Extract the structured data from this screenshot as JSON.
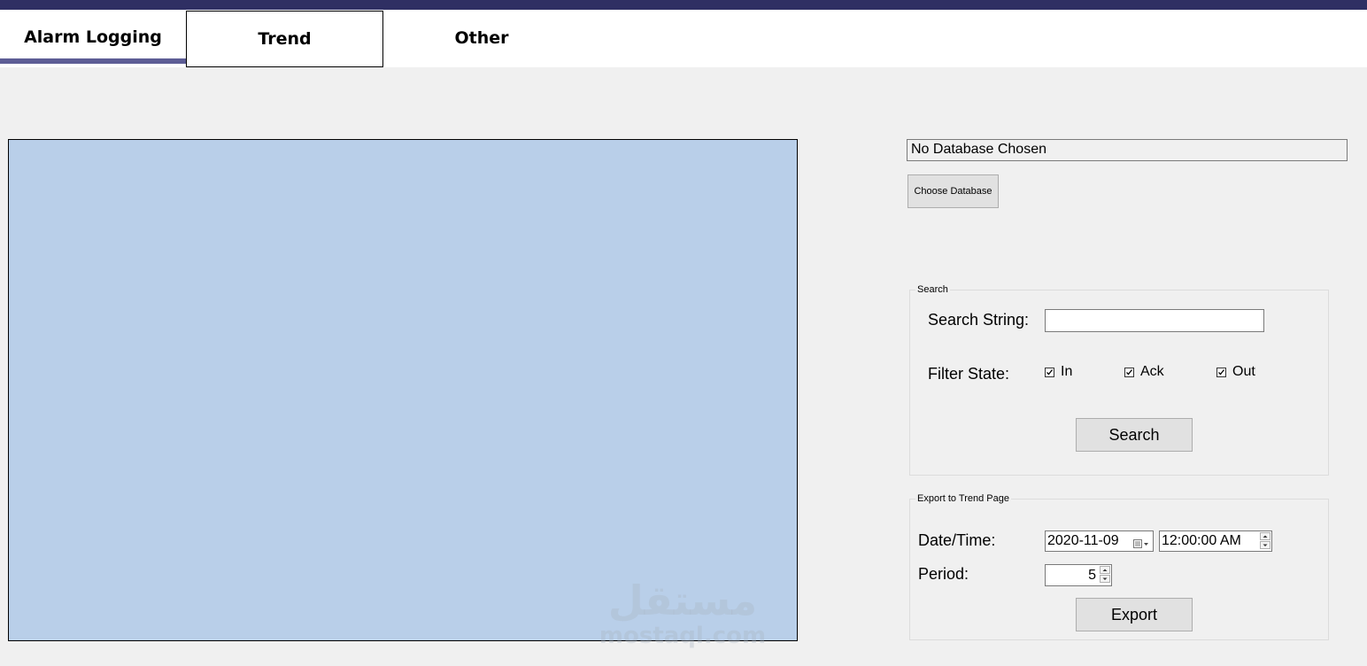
{
  "tabs": [
    {
      "label": "Alarm Logging"
    },
    {
      "label": "Trend"
    },
    {
      "label": "Other"
    }
  ],
  "database": {
    "status": "No Database Chosen",
    "choose_label": "Choose Database"
  },
  "search_group": {
    "title": "Search",
    "search_string_label": "Search String:",
    "search_string_value": "",
    "filter_state_label": "Filter State:",
    "filters": [
      {
        "label": "In",
        "checked": true
      },
      {
        "label": "Ack",
        "checked": true
      },
      {
        "label": "Out",
        "checked": true
      }
    ],
    "search_button": "Search"
  },
  "export_group": {
    "title": "Export to Trend Page",
    "datetime_label": "Date/Time:",
    "date_value": "2020-11-09",
    "time_value": "12:00:00 AM",
    "period_label": "Period:",
    "period_value": "5",
    "export_button": "Export"
  },
  "watermark": {
    "logo": "مستقل",
    "site": "mostaql.com"
  },
  "colors": {
    "topbar": "#2f2f63",
    "tab_underline": "#5d5d95",
    "viewer_bg": "#b9cfe9",
    "window_bg": "#f0f0f0"
  }
}
